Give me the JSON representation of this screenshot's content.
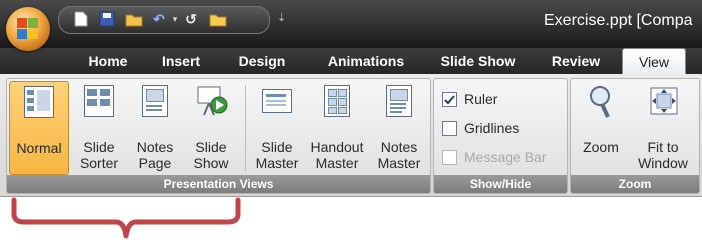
{
  "window": {
    "title": "Exercise.ppt [Compa"
  },
  "quick_access": {
    "items": [
      {
        "name": "new-icon",
        "glyph": "▮"
      },
      {
        "name": "save-icon",
        "glyph": "▣"
      },
      {
        "name": "open-folder-icon",
        "glyph": "▰"
      },
      {
        "name": "undo-icon",
        "glyph": "↶"
      },
      {
        "name": "undo-dropdown-icon",
        "glyph": "▾"
      },
      {
        "name": "redo-icon",
        "glyph": "↺"
      },
      {
        "name": "folder-icon",
        "glyph": "▰"
      }
    ],
    "customize_glyph": "⇣"
  },
  "tabs": [
    {
      "label": "Home",
      "active": false
    },
    {
      "label": "Insert",
      "active": false
    },
    {
      "label": "Design",
      "active": false
    },
    {
      "label": "Animations",
      "active": false
    },
    {
      "label": "Slide Show",
      "active": false
    },
    {
      "label": "Review",
      "active": false
    },
    {
      "label": "View",
      "active": true
    }
  ],
  "groups": {
    "presentation_views": {
      "label": "Presentation Views",
      "buttons": [
        {
          "line1": "Normal",
          "line2": "",
          "active": true
        },
        {
          "line1": "Slide",
          "line2": "Sorter",
          "active": false
        },
        {
          "line1": "Notes",
          "line2": "Page",
          "active": false
        },
        {
          "line1": "Slide",
          "line2": "Show",
          "active": false
        },
        {
          "line1": "Slide",
          "line2": "Master",
          "active": false
        },
        {
          "line1": "Handout",
          "line2": "Master",
          "active": false
        },
        {
          "line1": "Notes",
          "line2": "Master",
          "active": false
        }
      ]
    },
    "show_hide": {
      "label": "Show/Hide",
      "options": [
        {
          "label": "Ruler",
          "checked": true,
          "enabled": true
        },
        {
          "label": "Gridlines",
          "checked": false,
          "enabled": true
        },
        {
          "label": "Message Bar",
          "checked": false,
          "enabled": false
        }
      ]
    },
    "zoom": {
      "label": "Zoom",
      "buttons": [
        {
          "line1": "Zoom",
          "line2": ""
        },
        {
          "line1": "Fit to",
          "line2": "Window"
        }
      ]
    }
  },
  "colors": {
    "active_highlight": "#f7b640",
    "group_label_bg": "#8a8a8a",
    "brace_color": "#c0444a"
  }
}
